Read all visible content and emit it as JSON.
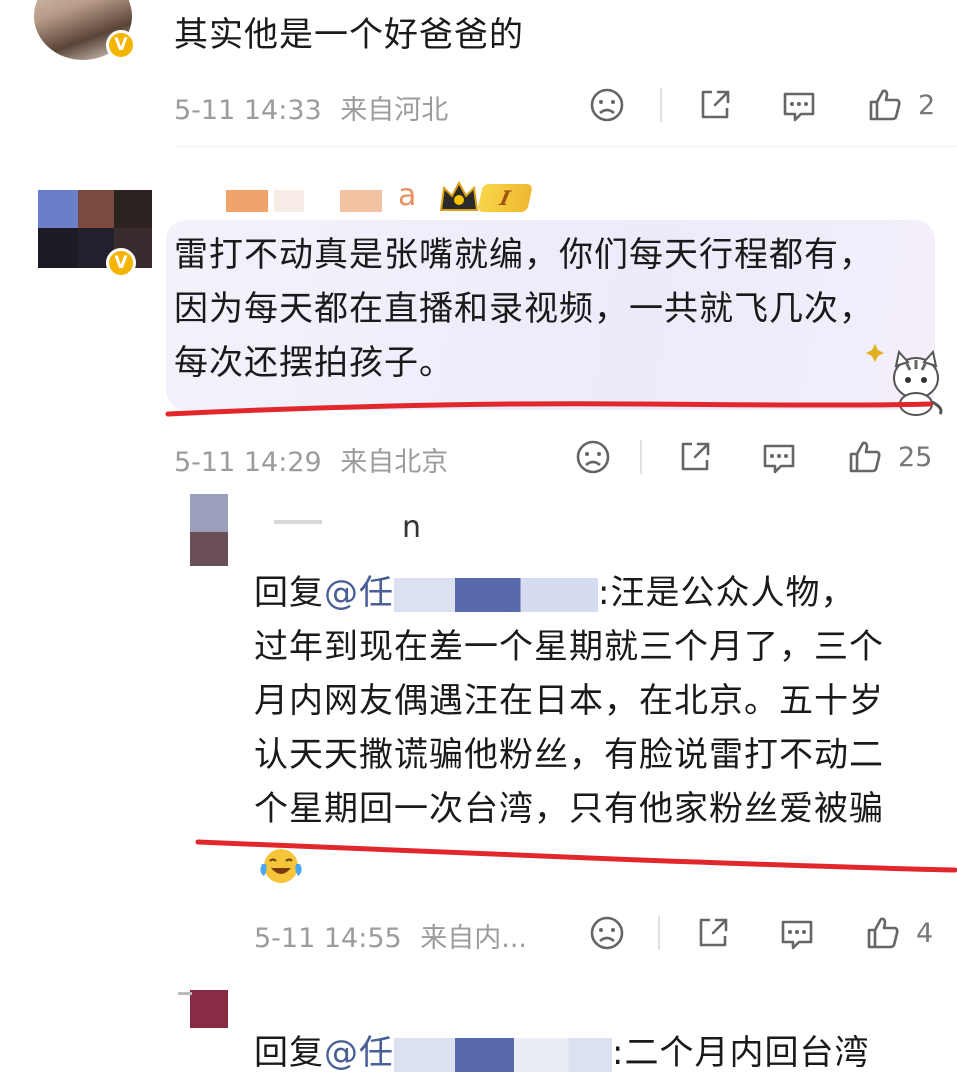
{
  "comments": [
    {
      "text": "其实他是一个好爸爸的",
      "time": "5-11 14:33",
      "location": "来自河北",
      "likes": "2"
    },
    {
      "name_visible": "a",
      "level_badge": "I",
      "text_lines": [
        "雷打不动真是张嘴就编，你们每天行程都有，",
        "因为每天都在直播和录视频，一共就飞几次，",
        "每次还摆拍孩子。"
      ],
      "time": "5-11 14:29",
      "location": "来自北京",
      "likes": "25"
    },
    {
      "reply_prefix": "回复",
      "mention_at": "@任",
      "name_visible": "n",
      "text_lines": [
        ":汪是公众人物，",
        "过年到现在差一个星期就三个月了，三个",
        "月内网友偶遇汪在日本，在北京。五十岁",
        "认天天撒谎骗他粉丝，有脸说雷打不动二",
        "个星期回一次台湾，只有他家粉丝爱被骗"
      ],
      "time": "5-11 14:55",
      "location": "来自内...",
      "likes": "4"
    },
    {
      "reply_prefix": "回复",
      "mention_at": "@任",
      "text": ":二个月内回台湾"
    }
  ],
  "icons": [
    "sad-face-icon",
    "share-icon",
    "comment-icon",
    "like-icon",
    "verified-badge-icon",
    "crown-icon",
    "cat-sticker-icon",
    "laugh-cry-emoji-icon"
  ],
  "colors": {
    "accent_underline": "#e0282c",
    "verified": "#f5b400",
    "mention": "#4a5f96",
    "meta": "#9c9c9c"
  }
}
